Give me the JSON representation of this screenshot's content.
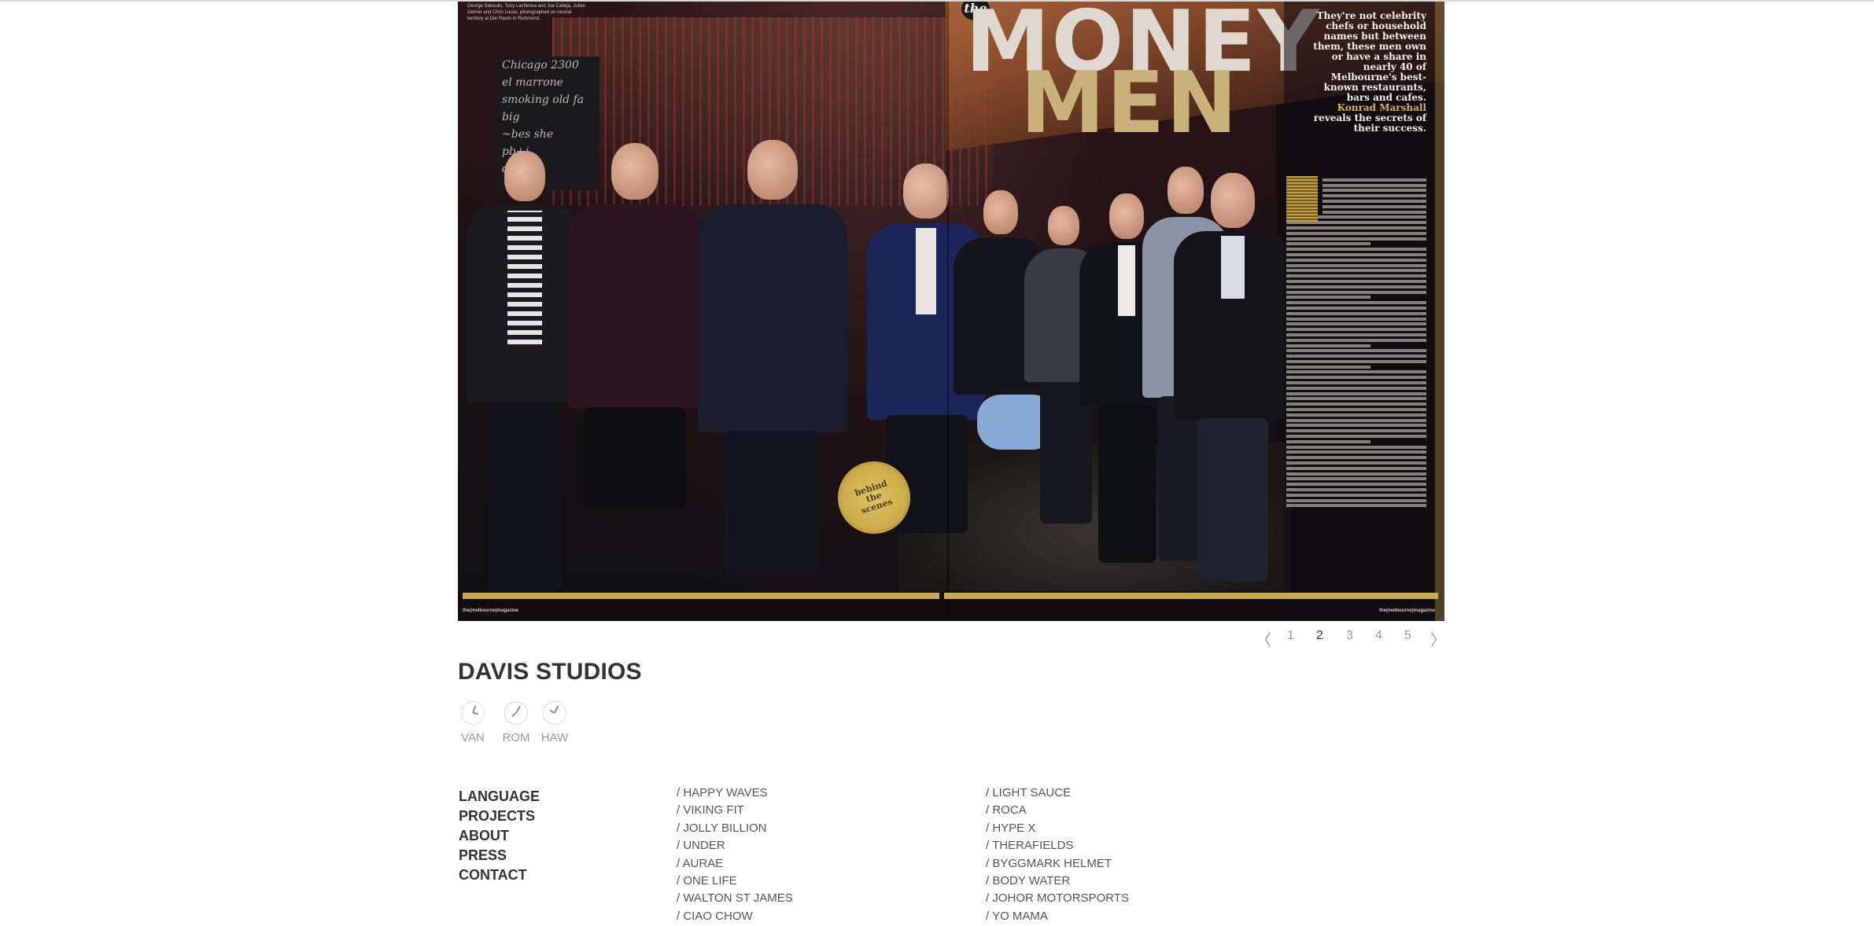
{
  "spread": {
    "the_word": "the",
    "headline_top": "MONEY",
    "headline_bottom": "MEN",
    "caption": "George Sakoulis, Tony Lachimea and Joe Calleja, Julian Gerner and Chris Lucas, photographed on neutral territory at Der Raum in Richmond.",
    "tagline_pre": "They're not celebrity chefs or household names but between them, these men own or have a share in nearly 40 of Melbourne's best-known restaurants, bars and cafes.",
    "tagline_author": "Konrad Marshall",
    "tagline_post": "reveals the secrets of their success.",
    "seal_text": "behind the scenes",
    "chalk_lines": [
      "Chicago 2300",
      "el marrone",
      "smoking old fa",
      "big",
      "~bes she",
      "pb+j",
      "death"
    ],
    "footer_left": "the(melbourne)magazine",
    "footer_right": "the(melbourne)magazine"
  },
  "pager": {
    "prev": "〈",
    "next": "〉",
    "pages": [
      "1",
      "2",
      "3",
      "4",
      "5"
    ],
    "active": "2"
  },
  "studio": {
    "name": "DAVIS STUDIOS",
    "clocks": [
      {
        "label": "VAN"
      },
      {
        "label": "ROM"
      },
      {
        "label": "HAW"
      }
    ]
  },
  "nav": {
    "items": [
      "LANGUAGE",
      "PROJECTS",
      "ABOUT",
      "PRESS",
      "CONTACT"
    ]
  },
  "projects": {
    "column1": [
      "/ HAPPY WAVES",
      "/ VIKING FIT",
      "/ JOLLY BILLION",
      "/ UNDER",
      "/ AURAE",
      "/ ONE LIFE",
      "/ WALTON ST JAMES",
      "/ CIAO CHOW"
    ],
    "column2": [
      "/ LIGHT SAUCE",
      "/ ROCA",
      "/ HYPE X",
      "/ THERAFIELDS",
      "/ BYGGMARK HELMET",
      "/ BODY WATER",
      "/ JOHOR MOTORSPORTS",
      "/ YO MAMA"
    ]
  }
}
